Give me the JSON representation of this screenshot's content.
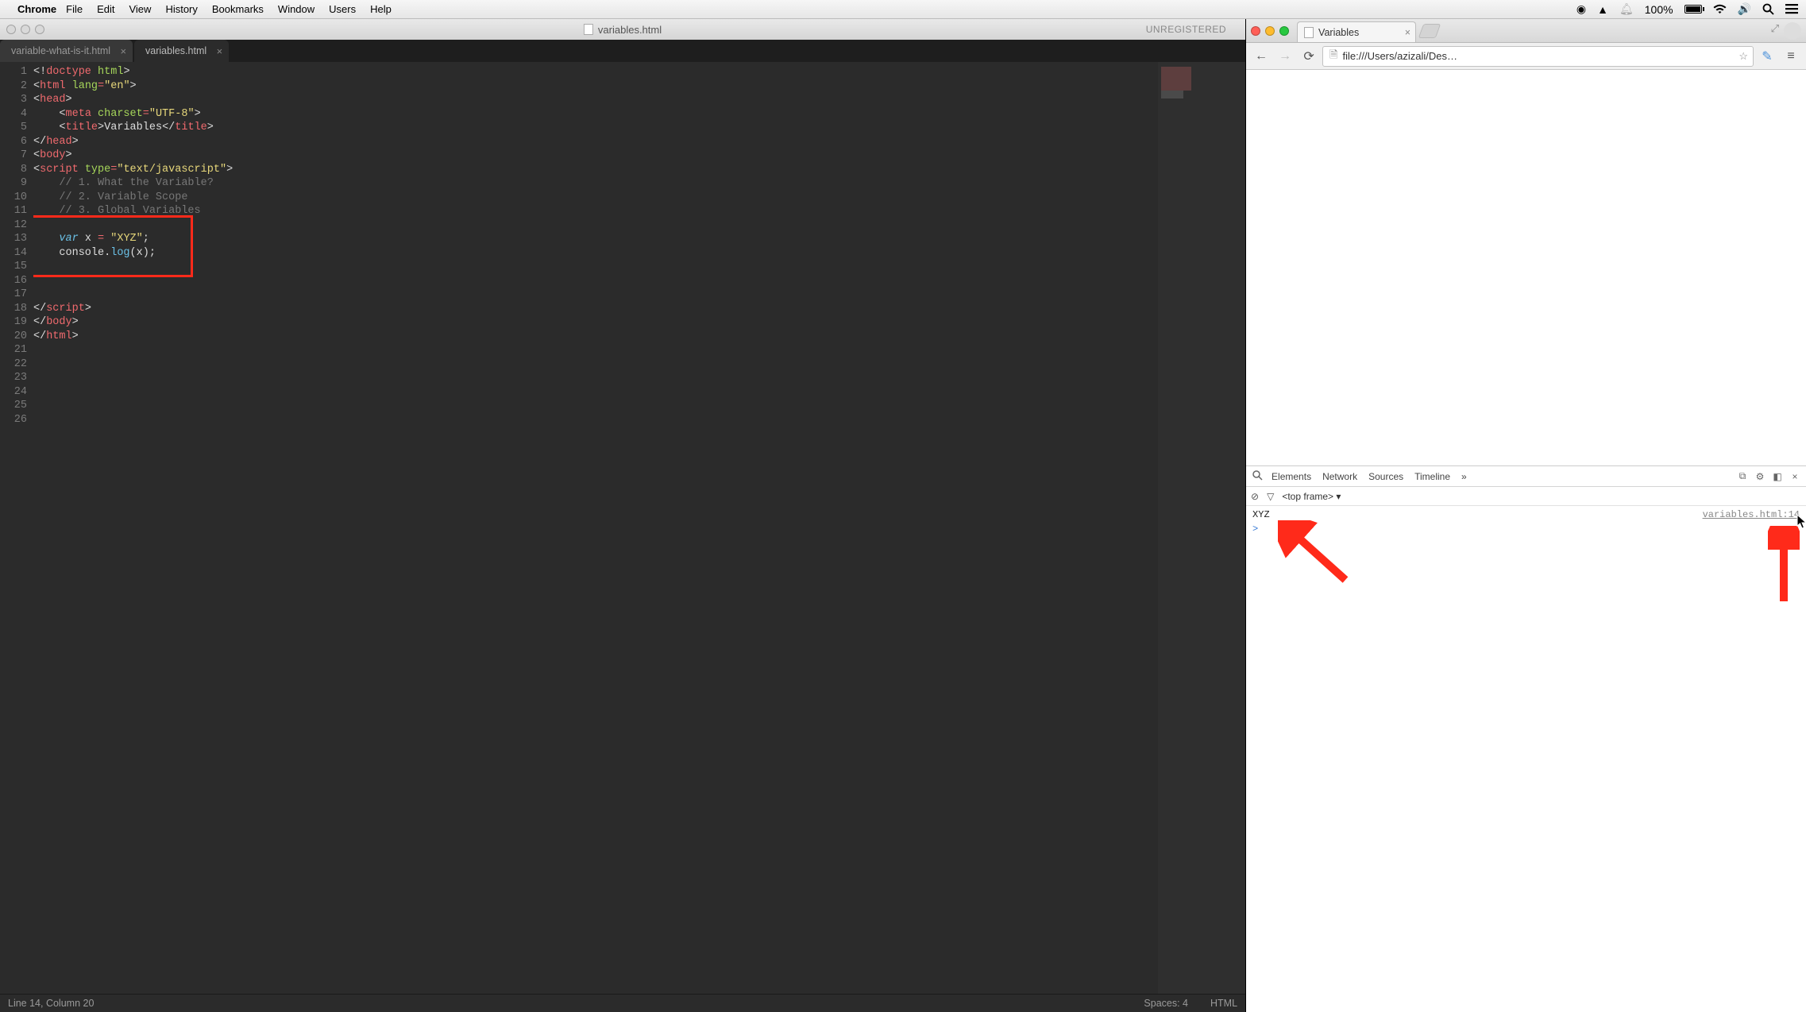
{
  "menubar": {
    "app": "Chrome",
    "items": [
      "File",
      "Edit",
      "View",
      "History",
      "Bookmarks",
      "Window",
      "Users",
      "Help"
    ],
    "battery_text": "100%"
  },
  "sublime": {
    "title_filename": "variables.html",
    "unregistered": "UNREGISTERED",
    "tabs": [
      {
        "label": "variable-what-is-it.html",
        "active": false
      },
      {
        "label": "variables.html",
        "active": true
      }
    ],
    "line_numbers": [
      "1",
      "2",
      "3",
      "4",
      "5",
      "6",
      "7",
      "8",
      "9",
      "10",
      "11",
      "12",
      "13",
      "14",
      "15",
      "16",
      "17",
      "18",
      "19",
      "20",
      "21",
      "22",
      "23",
      "24",
      "25",
      "26"
    ],
    "code_lines": {
      "l1": {
        "p1": "<!",
        "p2": "doctype",
        "p3": " ",
        "p4": "html",
        "p5": ">"
      },
      "l2": {
        "p1": "<",
        "p2": "html",
        "p3": " ",
        "p4": "lang",
        "p5": "=",
        "p6": "\"en\"",
        "p7": ">"
      },
      "l3": {
        "p1": "<",
        "p2": "head",
        "p3": ">"
      },
      "l4": {
        "p1": "    <",
        "p2": "meta",
        "p3": " ",
        "p4": "charset",
        "p5": "=",
        "p6": "\"UTF-8\"",
        "p7": ">"
      },
      "l5": {
        "p1": "    <",
        "p2": "title",
        "p3": ">",
        "p4": "Variables",
        "p5": "</",
        "p6": "title",
        "p7": ">"
      },
      "l6": {
        "p1": "</",
        "p2": "head",
        "p3": ">"
      },
      "l7": {
        "p1": "<",
        "p2": "body",
        "p3": ">"
      },
      "l8": {
        "p1": "<",
        "p2": "script",
        "p3": " ",
        "p4": "type",
        "p5": "=",
        "p6": "\"text/javascript\"",
        "p7": ">"
      },
      "l9": "    // 1. What the Variable?",
      "l10": "    // 2. Variable Scope",
      "l11": "    // 3. Global Variables",
      "l12": "",
      "l13": {
        "p1": "    ",
        "p2": "var",
        "p3": " x ",
        "p4": "=",
        "p5": " ",
        "p6": "\"XYZ\"",
        "p7": ";"
      },
      "l14": {
        "p1": "    console.",
        "p2": "log",
        "p3": "(x);"
      },
      "l15": "",
      "l16": "",
      "l17": "",
      "l18": {
        "p1": "</",
        "p2": "script",
        "p3": ">"
      },
      "l19": {
        "p1": "</",
        "p2": "body",
        "p3": ">"
      },
      "l20": {
        "p1": "</",
        "p2": "html",
        "p3": ">"
      }
    },
    "status": {
      "left": "Line 14, Column 20",
      "spaces": "Spaces: 4",
      "syntax": "HTML"
    }
  },
  "chrome": {
    "tab_title": "Variables",
    "url": "file:///Users/azizali/Des…",
    "devtools": {
      "tabs": [
        "Elements",
        "Network",
        "Sources",
        "Timeline"
      ],
      "overflow": "»",
      "frame_selector": "<top frame>",
      "console_rows": [
        {
          "msg": "XYZ",
          "src": "variables.html:14"
        }
      ],
      "prompt": ">"
    }
  }
}
